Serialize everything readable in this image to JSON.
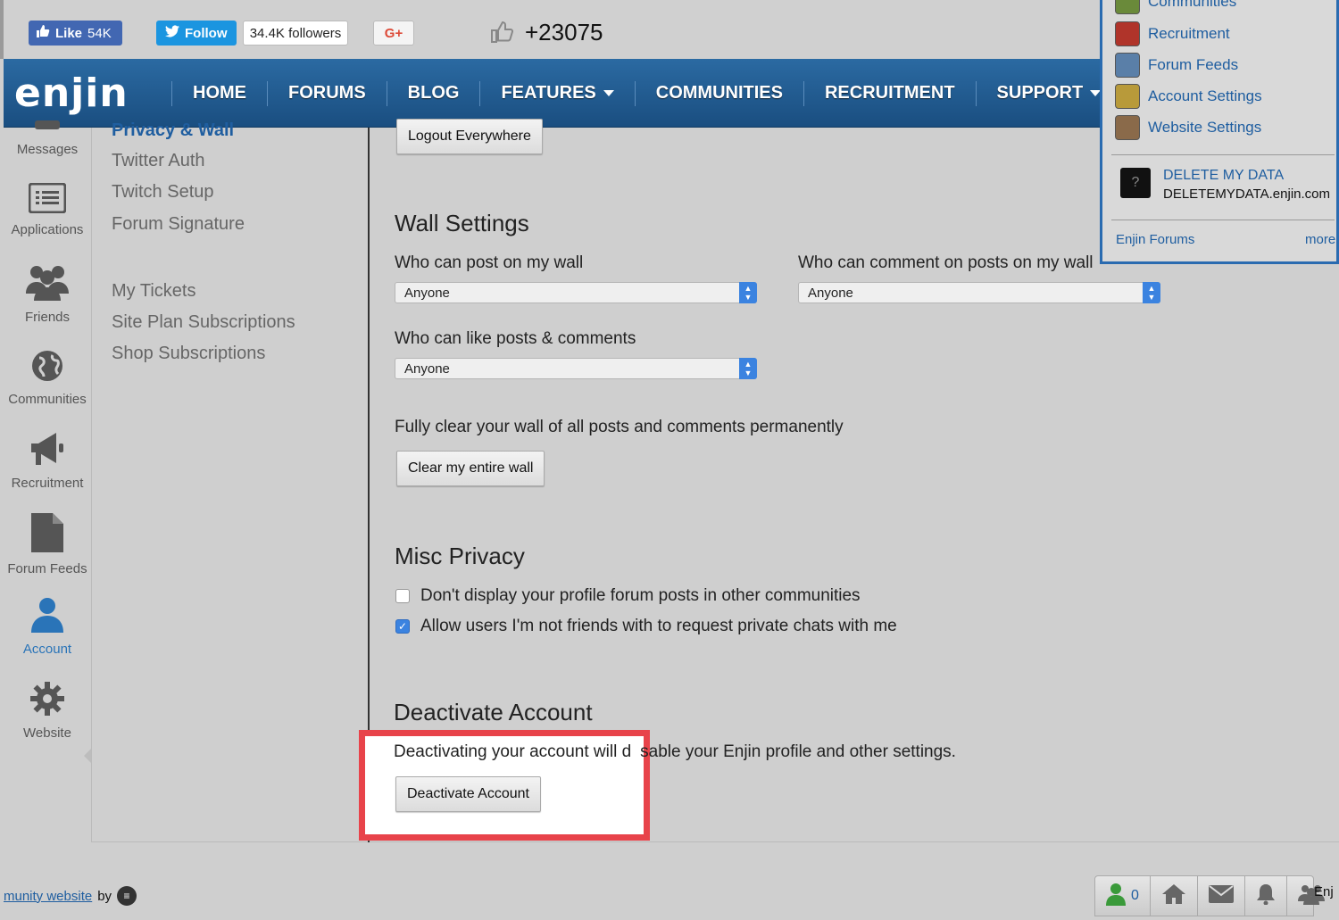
{
  "social": {
    "fb_like_label": "Like",
    "fb_like_count": "54K",
    "tw_follow_label": "Follow",
    "tw_followers": "34.4K followers",
    "gplus_label": "G+",
    "points": "+23075"
  },
  "nav": {
    "logo": "enjin",
    "items": [
      {
        "label": "HOME"
      },
      {
        "label": "FORUMS"
      },
      {
        "label": "BLOG"
      },
      {
        "label": "FEATURES",
        "dropdown": true
      },
      {
        "label": "COMMUNITIES"
      },
      {
        "label": "RECRUITMENT"
      },
      {
        "label": "SUPPORT",
        "dropdown": true
      }
    ]
  },
  "sidebar": {
    "items": [
      {
        "label": "Messages",
        "icon": "messages-icon"
      },
      {
        "label": "Applications",
        "icon": "applications-icon"
      },
      {
        "label": "Friends",
        "icon": "friends-icon"
      },
      {
        "label": "Communities",
        "icon": "communities-icon"
      },
      {
        "label": "Recruitment",
        "icon": "megaphone-icon"
      },
      {
        "label": "Forum Feeds",
        "icon": "document-icon"
      },
      {
        "label": "Account",
        "icon": "user-icon",
        "active": true
      },
      {
        "label": "Website",
        "icon": "gear-icon"
      }
    ]
  },
  "submenu": {
    "active": "Privacy & Wall",
    "items": [
      "Twitter Auth",
      "Twitch Setup",
      "Forum Signature"
    ],
    "items2": [
      "My Tickets",
      "Site Plan Subscriptions",
      "Shop Subscriptions"
    ]
  },
  "content": {
    "logout_everywhere": "Logout Everywhere",
    "wall_title": "Wall Settings",
    "who_post_label": "Who can post on my wall",
    "who_post_value": "Anyone",
    "who_comment_label": "Who can comment on posts on my wall",
    "who_comment_value": "Anyone",
    "who_like_label": "Who can like posts & comments",
    "who_like_value": "Anyone",
    "clear_desc": "Fully clear your wall of all posts and comments permanently",
    "clear_button": "Clear my entire wall",
    "misc_title": "Misc Privacy",
    "misc_opt1": "Don't display your profile forum posts in other communities",
    "misc_opt1_checked": false,
    "misc_opt2": "Allow users I'm not friends with to request private chats with me",
    "misc_opt2_checked": true,
    "deactivate_title": "Deactivate Account",
    "deactivate_desc_a": "Deactivating your account will d",
    "deactivate_desc_b": "sable your Enjin profile and other settings.",
    "deactivate_button": "Deactivate Account"
  },
  "dropdown": {
    "items": [
      {
        "label": "Communities",
        "icon": "communities-icon"
      },
      {
        "label": "Recruitment",
        "icon": "recruitment-icon"
      },
      {
        "label": "Forum Feeds",
        "icon": "forum-feeds-icon"
      },
      {
        "label": "Account Settings",
        "icon": "account-settings-icon"
      },
      {
        "label": "Website Settings",
        "icon": "website-settings-icon"
      }
    ],
    "app_title": "DELETE MY DATA",
    "app_subtitle": "DELETEMYDATA.enjin.com",
    "footer_left": "Enjin Forums",
    "footer_right": "more"
  },
  "footer": {
    "link_text": "munity website ",
    "by_text": "by",
    "friends_count": "0",
    "enj_text": "Enj"
  },
  "colors": {
    "nav_blue": "#1f5ea0",
    "highlight_red": "#e8434a",
    "checkbox_blue": "#3b83e0"
  }
}
